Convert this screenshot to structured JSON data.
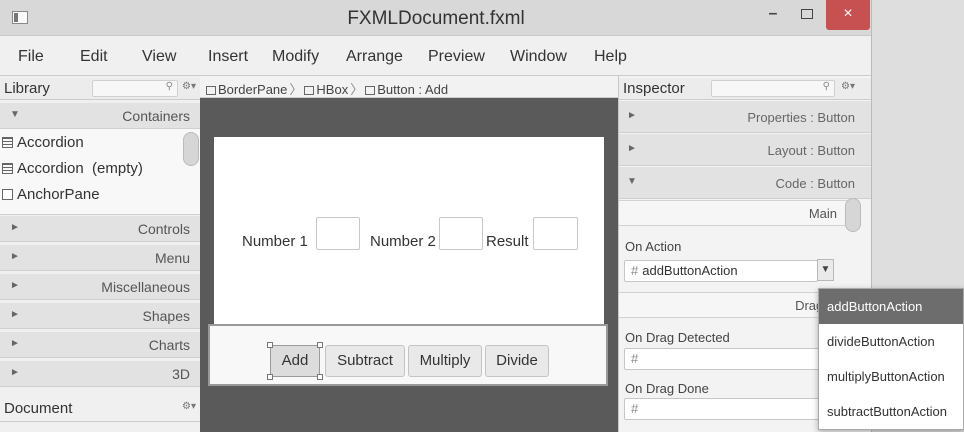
{
  "window": {
    "title": "FXMLDocument.fxml",
    "minimize_glyph": "–",
    "close_glyph": "×"
  },
  "menu": [
    "File",
    "Edit",
    "View",
    "Insert",
    "Modify",
    "Arrange",
    "Preview",
    "Window",
    "Help"
  ],
  "library": {
    "title": "Library",
    "sections": [
      {
        "label": "Containers",
        "expanded": true
      },
      {
        "label": "Controls",
        "expanded": false
      },
      {
        "label": "Menu",
        "expanded": false
      },
      {
        "label": "Miscellaneous",
        "expanded": false
      },
      {
        "label": "Shapes",
        "expanded": false
      },
      {
        "label": "Charts",
        "expanded": false
      },
      {
        "label": "3D",
        "expanded": false
      }
    ],
    "items": [
      "Accordion",
      "Accordion  (empty)",
      "AnchorPane"
    ]
  },
  "document": {
    "title": "Document"
  },
  "breadcrumb": [
    "BorderPane",
    "HBox",
    "Button : Add"
  ],
  "form": {
    "labels": [
      "Number 1",
      "Number 2",
      "Result"
    ],
    "buttons": [
      "Add",
      "Subtract",
      "Multiply",
      "Divide"
    ],
    "selected_button": "Add"
  },
  "inspector": {
    "title": "Inspector",
    "sections": [
      {
        "label": "Properties : Button",
        "expanded": false
      },
      {
        "label": "Layout : Button",
        "expanded": false
      },
      {
        "label": "Code : Button",
        "expanded": true
      }
    ],
    "main_label": "Main",
    "on_action_label": "On Action",
    "on_action_value": "addButtonAction",
    "hash": "#",
    "dragdrop_label": "DragDr",
    "on_drag_detected_label": "On Drag Detected",
    "on_drag_done_label": "On Drag Done"
  },
  "dropdown": {
    "options": [
      "addButtonAction",
      "divideButtonAction",
      "multiplyButtonAction",
      "subtractButtonAction"
    ],
    "selected": "addButtonAction"
  },
  "icons": {
    "expanded": "▼",
    "collapsed": "►",
    "search": "⚲",
    "settings": "⚙▾",
    "breadcrumb_sep": "〉",
    "combo": "▼"
  }
}
